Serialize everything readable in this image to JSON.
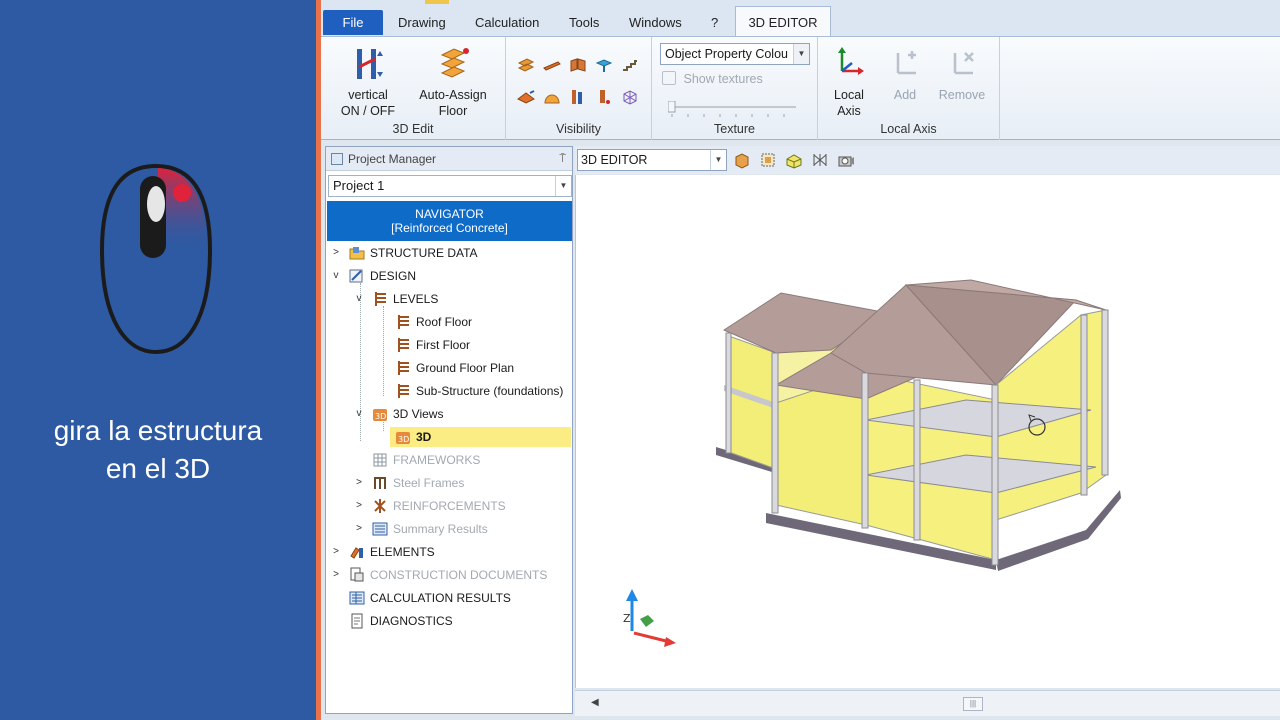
{
  "tutorial": {
    "caption_line1": "gira la estructura",
    "caption_line2": "en el 3D"
  },
  "ribbon": {
    "tabs": [
      {
        "label": "File"
      },
      {
        "label": "Drawing"
      },
      {
        "label": "Calculation"
      },
      {
        "label": "Tools"
      },
      {
        "label": "Windows"
      },
      {
        "label": "?"
      },
      {
        "label": "3D EDITOR"
      }
    ],
    "active_tab": "3D EDITOR",
    "groups": {
      "edit3d": {
        "label": "3D Edit",
        "vertical_line1": "vertical",
        "vertical_line2": "ON / OFF",
        "autoassign_line1": "Auto-Assign",
        "autoassign_line2": "Floor"
      },
      "visibility": {
        "label": "Visibility"
      },
      "texture": {
        "label": "Texture",
        "property_select": "Object Property Colou",
        "show_textures": "Show textures"
      },
      "local_axis": {
        "label": "Local Axis",
        "local_line1": "Local",
        "local_line2": "Axis",
        "add": "Add",
        "remove": "Remove"
      }
    }
  },
  "project_manager": {
    "title": "Project Manager",
    "pin": "⍑",
    "project": "Project 1",
    "navigator_line1": "NAVIGATOR",
    "navigator_line2": "[Reinforced Concrete]",
    "tree": {
      "structure_data": "STRUCTURE DATA",
      "design": "DESIGN",
      "levels": "LEVELS",
      "roof_floor": "Roof Floor",
      "first_floor": "First Floor",
      "ground_floor": "Ground Floor Plan",
      "substructure": "Sub-Structure (foundations)",
      "views3d": "3D Views",
      "view3d": "3D",
      "frameworks": "FRAMEWORKS",
      "steel_frames": "Steel Frames",
      "reinforcements": "REINFORCEMENTS",
      "summary_results": "Summary Results",
      "elements": "ELEMENTS",
      "construction_docs": "CONSTRUCTION DOCUMENTS",
      "calc_results": "CALCULATION RESULTS",
      "diagnostics": "DIAGNOSTICS"
    }
  },
  "viewport": {
    "view_select": "3D EDITOR",
    "axis_label_z": "Z"
  },
  "colors": {
    "side_panel": "#2d5aa3",
    "accent": "#e8734a",
    "navigator": "#0f6bc8",
    "selection": "#fbec83",
    "slab_roof": "#b49c99",
    "glass": "#f2ef6a"
  }
}
